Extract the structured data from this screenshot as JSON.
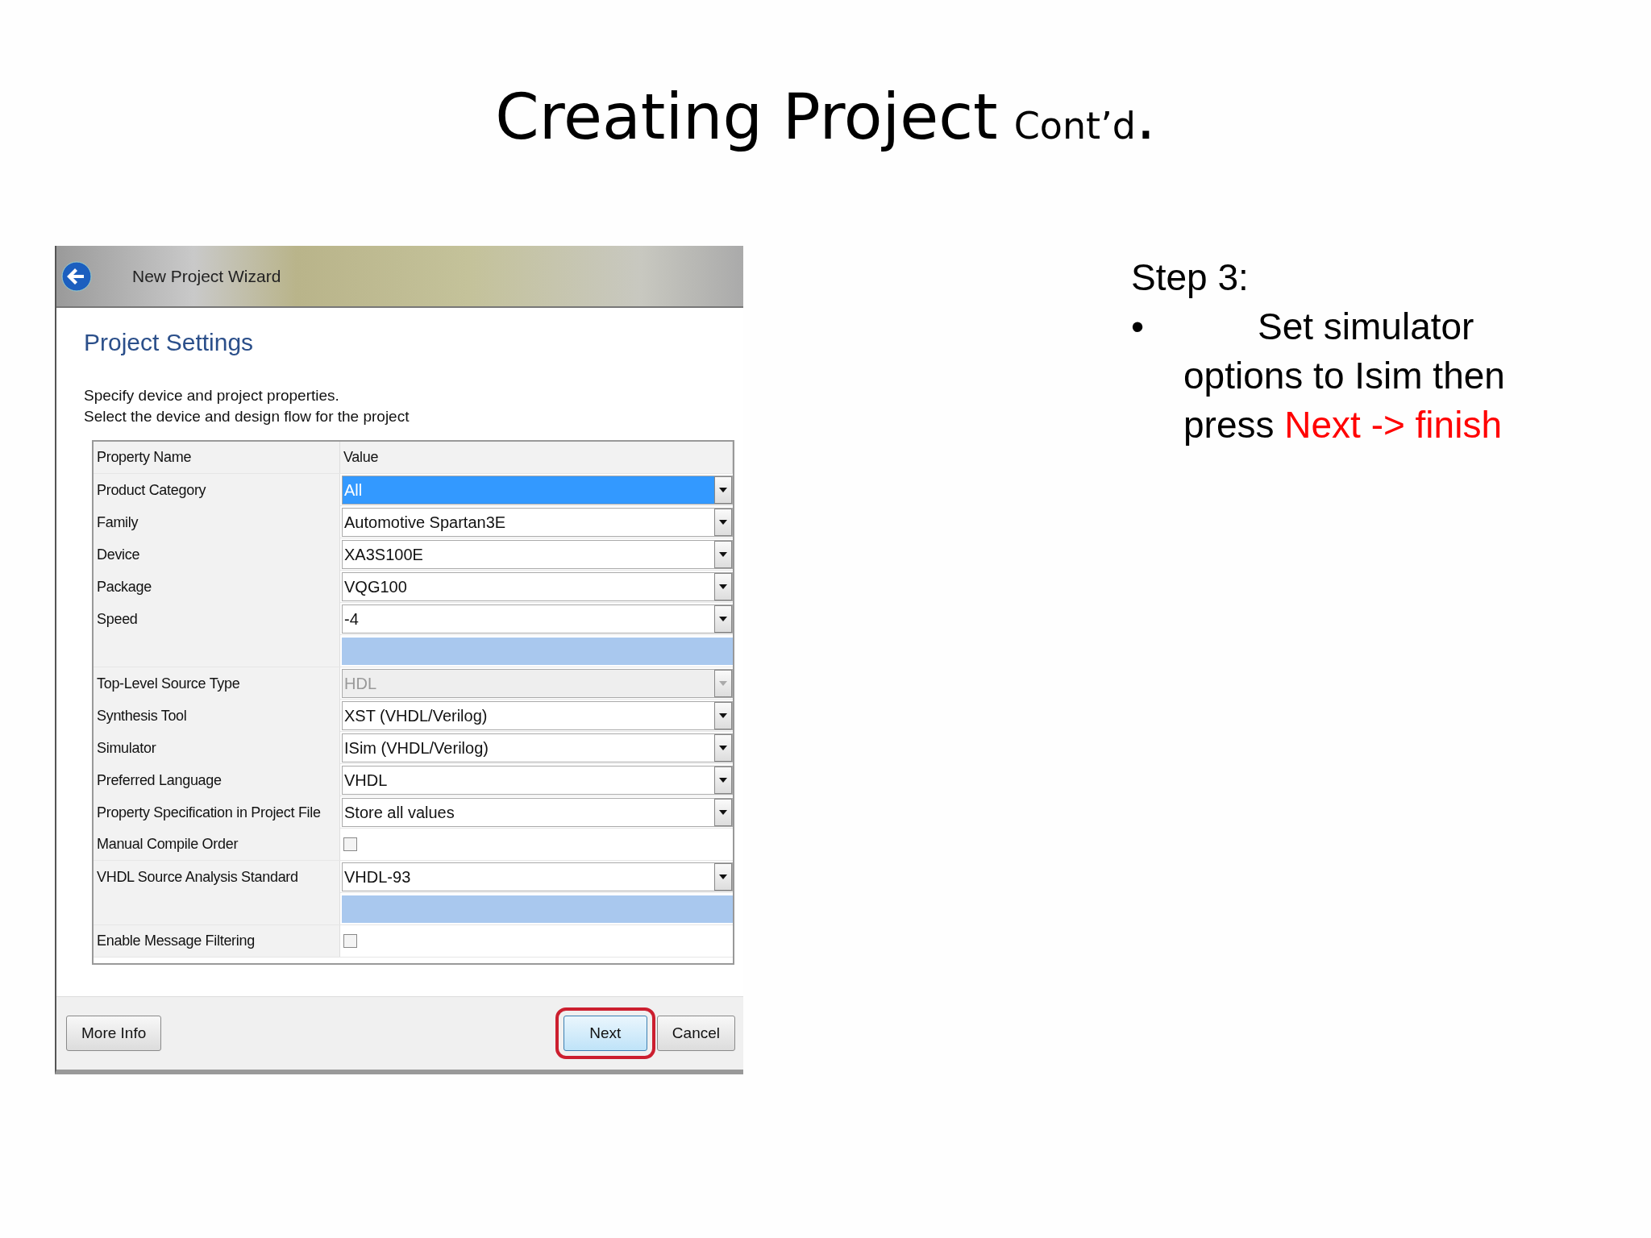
{
  "slide": {
    "title": "Creating Project",
    "title_suffix": "Cont’d",
    "title_end": "."
  },
  "wizard": {
    "title": "New Project Wizard",
    "heading": "Project Settings",
    "description": [
      "Specify device and project properties.",
      "Select the device and design flow for the project"
    ],
    "table": {
      "columns": [
        "Property Name",
        "Value"
      ],
      "rows": [
        {
          "kind": "select",
          "name": "Product Category",
          "value": "All",
          "selected": true,
          "disabled": false
        },
        {
          "kind": "select",
          "name": "Family",
          "value": "Automotive Spartan3E",
          "selected": false,
          "disabled": false
        },
        {
          "kind": "select",
          "name": "Device",
          "value": "XA3S100E",
          "selected": false,
          "disabled": false
        },
        {
          "kind": "select",
          "name": "Package",
          "value": "VQG100",
          "selected": false,
          "disabled": false
        },
        {
          "kind": "select",
          "name": "Speed",
          "value": "-4",
          "selected": false,
          "disabled": false
        },
        {
          "kind": "blank"
        },
        {
          "kind": "select",
          "name": "Top-Level Source Type",
          "value": "HDL",
          "selected": false,
          "disabled": true
        },
        {
          "kind": "select",
          "name": "Synthesis Tool",
          "value": "XST (VHDL/Verilog)",
          "selected": false,
          "disabled": false
        },
        {
          "kind": "select",
          "name": "Simulator",
          "value": "ISim (VHDL/Verilog)",
          "selected": false,
          "disabled": false
        },
        {
          "kind": "select",
          "name": "Preferred Language",
          "value": "VHDL",
          "selected": false,
          "disabled": false
        },
        {
          "kind": "select",
          "name": "Property Specification in Project File",
          "value": "Store all values",
          "selected": false,
          "disabled": false
        },
        {
          "kind": "checkbox",
          "name": "Manual Compile Order",
          "checked": false
        },
        {
          "kind": "select",
          "name": "VHDL Source Analysis Standard",
          "value": "VHDL-93",
          "selected": false,
          "disabled": false
        },
        {
          "kind": "blank"
        },
        {
          "kind": "checkbox",
          "name": "Enable Message Filtering",
          "checked": false
        }
      ]
    },
    "buttons": [
      {
        "label": "More Info",
        "highlighted": false
      },
      {
        "label": "Next",
        "highlighted": true
      },
      {
        "label": "Cancel",
        "highlighted": false
      }
    ]
  },
  "notes": {
    "heading": "Step 3:",
    "bullet": "•",
    "text": "Set simulator options to Isim then press",
    "highlight": "Next -> finish"
  }
}
